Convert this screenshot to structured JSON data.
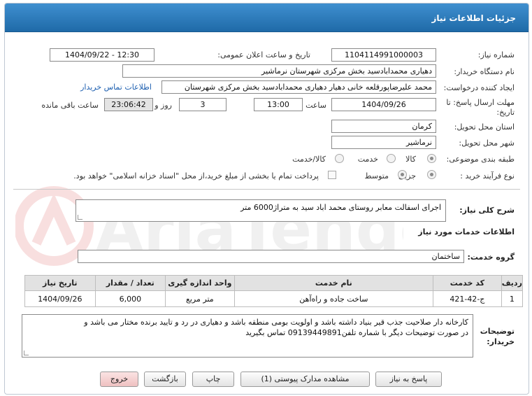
{
  "header": {
    "title": "جزئیات اطلاعات نیاز"
  },
  "form": {
    "need_number_label": "شماره نیاز:",
    "need_number": "1104114991000003",
    "announce_label": "تاریخ و ساعت اعلان عمومی:",
    "announce_value": "1404/09/22 - 12:30",
    "buyer_org_label": "نام دستگاه خریدار:",
    "buyer_org": "دهیاری محمدابادسید بخش مرکزی شهرستان نرماشیر",
    "requester_label": "ایجاد کننده درخواست:",
    "requester": "محمد علیرضاپورقلعه خانی دهیار دهیاری محمدابادسید بخش مرکزی شهرستان",
    "contact_link": "اطلاعات تماس خریدار",
    "deadline_label": "مهلت ارسال پاسخ: تا",
    "deadline_label2": "تاریخ:",
    "deadline_date": "1404/09/26",
    "time_label": "ساعت",
    "deadline_time": "13:00",
    "days_value": "3",
    "days_label": "روز و",
    "remaining_time": "23:06:42",
    "remaining_label": "ساعت باقی مانده",
    "province_label": "استان محل تحویل:",
    "province": "کرمان",
    "city_label": "شهر محل تحویل:",
    "city": "نرماشیر",
    "category_label": "طبقه بندی موضوعی:",
    "category_options": [
      "کالا",
      "خدمت",
      "کالا/خدمت"
    ],
    "process_label": "نوع فرآیند خرید :",
    "process_options": [
      "جزیی",
      "متوسط"
    ],
    "payment_note": "پرداخت تمام یا بخشی از مبلغ خرید،از محل \"اسناد خزانه اسلامی\" خواهد بود."
  },
  "summary": {
    "label": "شرح کلی نیاز:",
    "text": "اجرای اسفالت  معابر روستای محمد اباد سید  به متراژ6000 متر"
  },
  "services": {
    "section_title": "اطلاعات خدمات مورد نیاز",
    "group_label": "گروه خدمت:",
    "group_value": "ساختمان",
    "columns": [
      "ردیف",
      "کد خدمت",
      "نام خدمت",
      "واحد اندازه گیری",
      "تعداد / مقدار",
      "تاریخ نیاز"
    ],
    "rows": [
      {
        "row": "1",
        "code": "ج-42-421",
        "name": "ساخت جاده و راه‌آهن",
        "unit": "متر مربع",
        "qty": "6,000",
        "date": "1404/09/26"
      }
    ]
  },
  "buyer_notes": {
    "label_line1": "توضیحات",
    "label_line2": "خریدار:",
    "line1": "کارخانه دار صلاحیت جذب قیر بنیاد داشته باشد  و اولویت بومی منطقه باشد و دهیاری در رد و تایید  برنده مختار می باشد  و",
    "line2": "در صورت توضیحات دیگر با شماره تلفن09139449891  تماس بگیرید"
  },
  "buttons": {
    "reply": "پاسخ به نیاز",
    "attachments": "مشاهده مدارک پیوستی (1)",
    "print": "چاپ",
    "back": "بازگشت",
    "exit": "خروج"
  },
  "watermark": {
    "text": "AriaTender.net"
  },
  "colors": {
    "titlebar": "#2a78b8",
    "link": "#1d5fb0",
    "exit_button": "#efc1c1"
  }
}
